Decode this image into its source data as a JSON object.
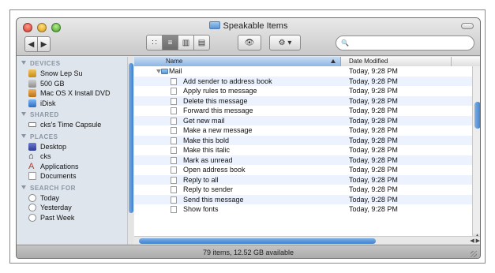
{
  "window": {
    "title": "Speakable Items",
    "status": "79 items, 12.52 GB available"
  },
  "search": {
    "placeholder": ""
  },
  "icons": {
    "nav_back": "◀",
    "nav_fwd": "▶",
    "view_icon": "∷",
    "view_list": "≡",
    "view_column": "▥",
    "view_coverflow": "▤",
    "quicklook": "👁",
    "action": "⚙ ▾",
    "search": "🔍"
  },
  "sidebar": {
    "devices": {
      "label": "DEVICES",
      "items": [
        "Snow Lep Su",
        "500 GB",
        "Mac OS X Install DVD",
        "iDisk"
      ]
    },
    "shared": {
      "label": "SHARED",
      "items": [
        "cks's Time Capsule"
      ]
    },
    "places": {
      "label": "PLACES",
      "items": [
        "Desktop",
        "cks",
        "Applications",
        "Documents"
      ]
    },
    "search_for": {
      "label": "SEARCH FOR",
      "items": [
        "Today",
        "Yesterday",
        "Past Week"
      ]
    }
  },
  "columns": {
    "name": "Name",
    "date": "Date Modified"
  },
  "folder": {
    "name": "Mail",
    "date": "Today, 9:28 PM"
  },
  "files": [
    {
      "name": "Add sender to address book",
      "date": "Today, 9:28 PM"
    },
    {
      "name": "Apply rules to message",
      "date": "Today, 9:28 PM"
    },
    {
      "name": "Delete this message",
      "date": "Today, 9:28 PM"
    },
    {
      "name": "Forward this message",
      "date": "Today, 9:28 PM"
    },
    {
      "name": "Get new mail",
      "date": "Today, 9:28 PM"
    },
    {
      "name": "Make a new message",
      "date": "Today, 9:28 PM"
    },
    {
      "name": "Make this bold",
      "date": "Today, 9:28 PM"
    },
    {
      "name": "Make this italic",
      "date": "Today, 9:28 PM"
    },
    {
      "name": "Mark as unread",
      "date": "Today, 9:28 PM"
    },
    {
      "name": "Open address book",
      "date": "Today, 9:28 PM"
    },
    {
      "name": "Reply to all",
      "date": "Today, 9:28 PM"
    },
    {
      "name": "Reply to sender",
      "date": "Today, 9:28 PM"
    },
    {
      "name": "Send this message",
      "date": "Today, 9:28 PM"
    },
    {
      "name": "Show fonts",
      "date": "Today, 9:28 PM"
    }
  ]
}
